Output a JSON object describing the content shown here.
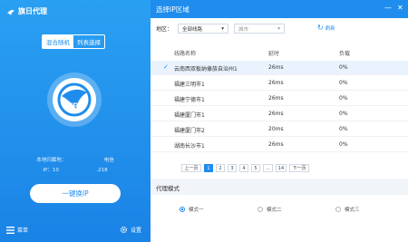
{
  "app": {
    "name": "旗日代理"
  },
  "left": {
    "mode_tabs": [
      {
        "label": "混合随机",
        "active": true
      },
      {
        "label": "列表选择",
        "active": false
      }
    ],
    "location_prefix": "本地归属地：",
    "location_suffix": "电信",
    "ip_label": "IP：10",
    "ip_suffix": ".218",
    "connect_label": "一键换IP",
    "menu_label": "菜单",
    "settings_label": "设置"
  },
  "right": {
    "title": "选择IP区域",
    "region_label": "地区：",
    "region_select": "全部线路",
    "city_select": "城市",
    "refresh_label": "刷新",
    "columns": {
      "name": "线路名称",
      "latency": "延时",
      "load": "负载"
    },
    "rows": [
      {
        "name": "云南西双板纳傣族自治州1",
        "latency": "26ms",
        "load": "0%",
        "selected": true
      },
      {
        "name": "福建三明市1",
        "latency": "26ms",
        "load": "0%",
        "selected": false
      },
      {
        "name": "福建宁德市1",
        "latency": "26ms",
        "load": "0%",
        "selected": false
      },
      {
        "name": "福建厦门市1",
        "latency": "26ms",
        "load": "0%",
        "selected": false
      },
      {
        "name": "福建厦门市2",
        "latency": "20ms",
        "load": "0%",
        "selected": false
      },
      {
        "name": "湖南长沙市1",
        "latency": "26ms",
        "load": "0%",
        "selected": false
      }
    ],
    "pager": {
      "prev": "上一页",
      "pages": [
        "1",
        "2",
        "3",
        "4",
        "5",
        "...",
        "14"
      ],
      "active_page": "1",
      "next": "下一页"
    },
    "proxy_mode": {
      "title": "代理模式",
      "options": [
        {
          "label": "模式一",
          "checked": true
        },
        {
          "label": "模式二",
          "checked": false
        },
        {
          "label": "模式三",
          "checked": false
        }
      ]
    }
  },
  "colors": {
    "brand_blue": "#1f8ded",
    "left_gradient_top": "#2aa0f2",
    "selected_row": "#eaf3fd"
  }
}
